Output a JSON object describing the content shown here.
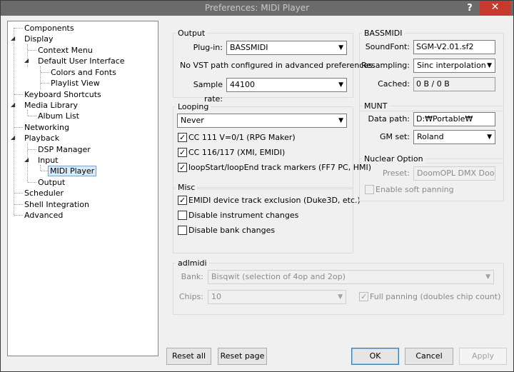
{
  "window": {
    "title": "Preferences: MIDI Player",
    "help": "?",
    "close": "✕"
  },
  "tree": {
    "items": [
      {
        "label": "Components"
      },
      {
        "label": "Display"
      },
      {
        "label": "Context Menu"
      },
      {
        "label": "Default User Interface"
      },
      {
        "label": "Colors and Fonts"
      },
      {
        "label": "Playlist View"
      },
      {
        "label": "Keyboard Shortcuts"
      },
      {
        "label": "Media Library"
      },
      {
        "label": "Album List"
      },
      {
        "label": "Networking"
      },
      {
        "label": "Playback"
      },
      {
        "label": "DSP Manager"
      },
      {
        "label": "Input"
      },
      {
        "label": "MIDI Player"
      },
      {
        "label": "Output"
      },
      {
        "label": "Scheduler"
      },
      {
        "label": "Shell Integration"
      },
      {
        "label": "Advanced"
      }
    ],
    "selected": "MIDI Player"
  },
  "output": {
    "title": "Output",
    "plugin_label": "Plug-in:",
    "plugin_value": "BASSMIDI",
    "vst_note": "No VST path configured in advanced preferences.",
    "rate_label": "Sample rate:",
    "rate_value": "44100"
  },
  "looping": {
    "title": "Looping",
    "mode_value": "Never",
    "cc111": "CC 111 V=0/1 (RPG Maker)",
    "cc116": "CC 116/117 (XMI, EMIDI)",
    "markers": "loopStart/loopEnd track markers (FF7 PC, HMI)",
    "cc111_checked": true,
    "cc116_checked": true,
    "markers_checked": true
  },
  "misc": {
    "title": "Misc",
    "emidi": "EMIDI device track exclusion (Duke3D, etc.)",
    "disable_instr": "Disable instrument changes",
    "disable_bank": "Disable bank changes",
    "emidi_checked": true,
    "disable_instr_checked": false,
    "disable_bank_checked": false
  },
  "bassmidi": {
    "title": "BASSMIDI",
    "soundfont_label": "SoundFont:",
    "soundfont_value": "SGM-V2.01.sf2",
    "resampling_label": "Resampling:",
    "resampling_value": "Sinc interpolation",
    "cached_label": "Cached:",
    "cached_value": "0 B / 0 B"
  },
  "munt": {
    "title": "MUNT",
    "datapath_label": "Data path:",
    "datapath_value": "D:₩Portable₩",
    "gmset_label": "GM set:",
    "gmset_value": "Roland"
  },
  "nuclear": {
    "title": "Nuclear Option",
    "preset_label": "Preset:",
    "preset_value": "DoomOPL DMX Door",
    "soft_panning": "Enable soft panning",
    "soft_panning_checked": false
  },
  "adlmidi": {
    "title": "adlmidi",
    "bank_label": "Bank:",
    "bank_value": "Bisqwit (selection of 4op and 2op)",
    "chips_label": "Chips:",
    "chips_value": "10",
    "full_panning": "Full panning (doubles chip count)",
    "full_panning_checked": true
  },
  "buttons": {
    "reset_all": "Reset all",
    "reset_page": "Reset page",
    "ok": "OK",
    "cancel": "Cancel",
    "apply": "Apply"
  },
  "glyphs": {
    "dropdown": "▼",
    "check": "✓",
    "expanded": "◢"
  }
}
